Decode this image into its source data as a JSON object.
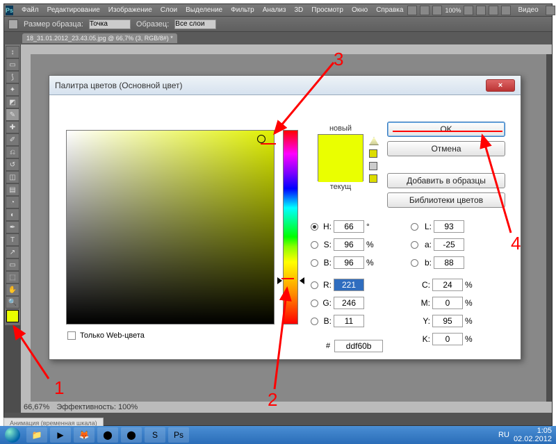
{
  "menubar": {
    "items": [
      "Файл",
      "Редактирование",
      "Изображение",
      "Слои",
      "Выделение",
      "Фильтр",
      "Анализ",
      "3D",
      "Просмотр",
      "Окно",
      "Справка"
    ],
    "zoom": "100%",
    "workspace_label": "Видео"
  },
  "optbar": {
    "label1": "Размер образца:",
    "sample": "Точка",
    "label2": "Образец:",
    "layers": "Все слои"
  },
  "doctab": "18_31.01.2012_23.43.05.jpg @ 66,7% (3, RGB/8#) *",
  "statusbar": {
    "zoom": "66,67%",
    "eff": "Эффективность: 100%"
  },
  "bottom_tab": "Анимация (временная шкала)",
  "dialog": {
    "title": "Палитра цветов (Основной цвет)",
    "close": "×",
    "new_label": "новый",
    "cur_label": "текущ",
    "ok": "OK",
    "cancel": "Отмена",
    "add": "Добавить в образцы",
    "libs": "Библиотеки цветов",
    "webonly": "Только Web-цвета",
    "hsb": {
      "h": "66",
      "s": "96",
      "b": "96"
    },
    "rgb": {
      "r": "221",
      "g": "246",
      "b": "11"
    },
    "lab": {
      "l": "93",
      "a": "-25",
      "b": "88"
    },
    "cmyk": {
      "c": "24",
      "m": "0",
      "y": "95",
      "k": "0"
    },
    "hex": "ddf60b",
    "labels": {
      "H": "H:",
      "S": "S:",
      "B": "B:",
      "R": "R:",
      "G": "G:",
      "Bb": "B:",
      "L": "L:",
      "a": "a:",
      "b": "b:",
      "C": "C:",
      "M": "M:",
      "Y": "Y:",
      "K": "K:",
      "deg": "°",
      "pct": "%",
      "hash": "#"
    }
  },
  "annotations": {
    "n1": "1",
    "n2": "2",
    "n3": "3",
    "n4": "4"
  },
  "taskbar": {
    "lang": "RU",
    "time": "1:05",
    "date": "02.02.2012"
  }
}
